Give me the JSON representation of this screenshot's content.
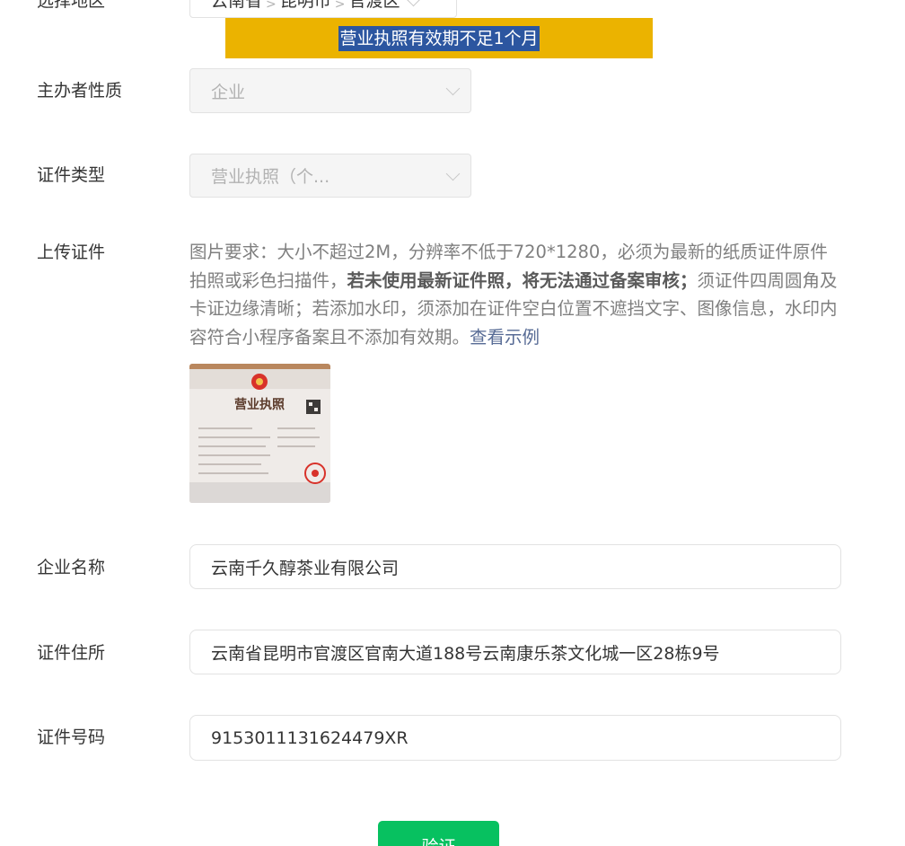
{
  "region": {
    "label": "选择地区",
    "province": "云南省",
    "city": "昆明市",
    "district": "官渡区",
    "separator": ">"
  },
  "banner": {
    "text": "营业执照有效期不足1个月",
    "color": "#ebb300"
  },
  "organizer_type": {
    "label": "主办者性质",
    "value": "企业"
  },
  "cert_type": {
    "label": "证件类型",
    "value": "营业执照（个..."
  },
  "upload": {
    "label": "上传证件",
    "req_part1": "图片要求：大小不超过2M，分辨率不低于720*1280，必须为最新的纸质证件原件拍照或彩色扫描件，",
    "req_bold": "若未使用最新证件照，将无法通过备案审核；",
    "req_part2": "须证件四周圆角及卡证边缘清晰；若添加水印，须添加在证件空白位置不遮挡文字、图像信息，水印内容符合小程序备案且不添加有效期。",
    "example_link": "查看示例",
    "thumbnail_title": "营业执照"
  },
  "company_name": {
    "label": "企业名称",
    "value": "云南千久醇茶业有限公司"
  },
  "cert_address": {
    "label": "证件住所",
    "value": "云南省昆明市官渡区官南大道188号云南康乐茶文化城一区28栋9号"
  },
  "cert_number": {
    "label": "证件号码",
    "value": "9153011131624479XR"
  },
  "verify_button": {
    "label": "验证",
    "color": "#07c160"
  }
}
